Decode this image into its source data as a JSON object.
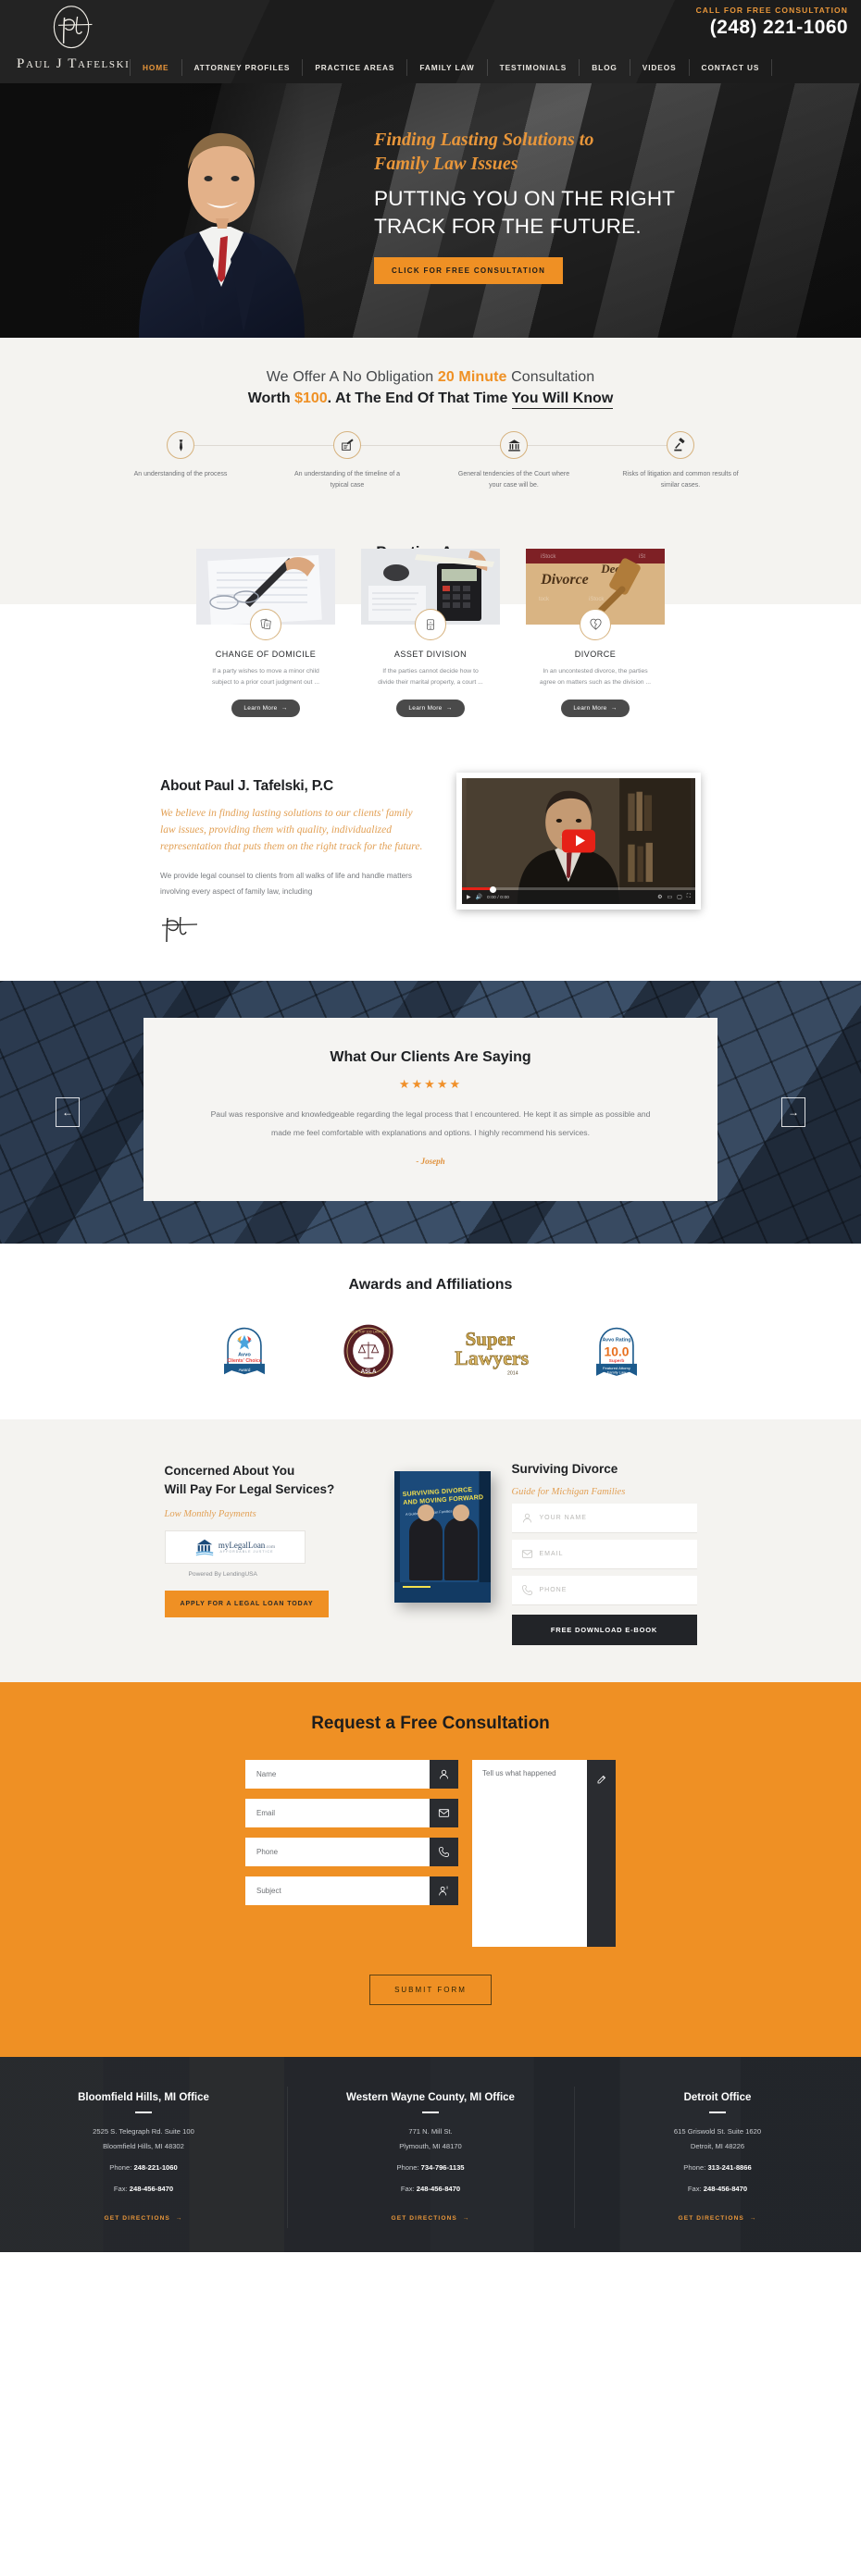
{
  "header": {
    "brand_name": "Paul J Tafelski",
    "call_label": "CALL FOR FREE CONSULTATION",
    "phone": "(248) 221-1060",
    "nav": [
      {
        "label": "HOME",
        "active": true
      },
      {
        "label": "ATTORNEY PROFILES",
        "active": false
      },
      {
        "label": "PRACTICE AREAS",
        "active": false
      },
      {
        "label": "FAMILY LAW",
        "active": false
      },
      {
        "label": "TESTIMONIALS",
        "active": false
      },
      {
        "label": "BLOG",
        "active": false
      },
      {
        "label": "VIDEOS",
        "active": false
      },
      {
        "label": "CONTACT US",
        "active": false
      }
    ]
  },
  "hero": {
    "script_line1": "Finding Lasting Solutions to",
    "script_line2": "Family Law Issues",
    "headline_line1": "PUTTING YOU ON THE RIGHT",
    "headline_line2": "TRACK FOR THE FUTURE.",
    "cta": "CLICK FOR FREE CONSULTATION"
  },
  "consult": {
    "line1_a": "We Offer A No Obligation ",
    "line1_accent": "20 Minute",
    "line1_b": " Consultation",
    "line2_a": "Worth ",
    "line2_amount": "$100",
    "line2_b": ". At The End Of That Time ",
    "line2_underline": "You Will Know",
    "steps": [
      {
        "icon": "tie-icon",
        "text": "An understanding of the process"
      },
      {
        "icon": "document-pen-icon",
        "text": "An understanding of the timeline of a typical case"
      },
      {
        "icon": "courthouse-icon",
        "text": "General tendencies of the Court where your case will be."
      },
      {
        "icon": "gavel-icon",
        "text": "Risks of litigation and common results of similar cases."
      }
    ]
  },
  "practice": {
    "title": "Practice Areas",
    "prev_arrow": "‹",
    "next_arrow": "›",
    "cards": [
      {
        "title": "CHANGE OF DOMICILE",
        "desc": "If a party wishes to move a minor child subject to a prior court judgment out ...",
        "button": "Learn More",
        "icon": "documents-icon"
      },
      {
        "title": "ASSET DIVISION",
        "desc": "If the parties cannot decide how to divide their marital property, a court ...",
        "button": "Learn More",
        "icon": "split-icon"
      },
      {
        "title": "DIVORCE",
        "desc": "In an uncontested divorce, the parties agree on matters such as the division ...",
        "button": "Learn More",
        "icon": "broken-heart-icon"
      }
    ]
  },
  "about": {
    "title": "About Paul J. Tafelski, P.C",
    "script": "We believe in finding lasting solutions to our clients' family law issues, providing them with quality, individualized representation that puts them on the right track for the future.",
    "body": "We provide legal counsel to clients from all walks of life and handle matters involving every aspect of family law, including",
    "video_time": "0:00 / 0:00"
  },
  "testimonials": {
    "title": "What Our Clients Are Saying",
    "stars": "★★★★★",
    "quote": "Paul was responsive and knowledgeable regarding the legal process that I encountered. He kept it as simple as possible and made me feel comfortable with explanations and options. I highly recommend his services.",
    "author": "- Joseph",
    "prev_arrow": "←",
    "next_arrow": "→"
  },
  "awards": {
    "title": "Awards and Affiliations",
    "badges": [
      {
        "name": "avvo-clients-choice-badge",
        "brand": "Avvo",
        "line1": "Clients' Choice",
        "year": "2014",
        "ribbon": "Award"
      },
      {
        "name": "asla-top-100-badge",
        "ring_text": "2015 TOP 100 LAWYER",
        "label": "ASLA"
      },
      {
        "name": "super-lawyers-badge",
        "line1": "Super",
        "line2": "Lawyers",
        "year": "2014"
      },
      {
        "name": "avvo-rating-badge",
        "brand": "Avvo Rating",
        "score": "10.0",
        "label": "Superb",
        "ribbon1": "Featured Attorny",
        "ribbon2": "Family Law"
      }
    ]
  },
  "services": {
    "left_title_l1": "Concerned About You",
    "left_title_l2": "Will Pay For Legal Services?",
    "left_sub": "Low Monthly Payments",
    "loan_logo_main": "myLegalLoan",
    "loan_logo_com": ".com",
    "loan_logo_tag": "AFFORDABLE JUSTICE",
    "powered_by": "Powered By LendingUSA",
    "loan_button": "APPLY FOR A LEGAL LOAN TODAY",
    "book_title": "SURVIVING DIVORCE AND MOVING FORWARD",
    "book_sub": "A Guide for Michigan Families",
    "right_title": "Surviving Divorce",
    "right_sub": "Guide for Michigan Families",
    "fields": [
      {
        "placeholder": "YOUR NAME",
        "icon": "user-icon"
      },
      {
        "placeholder": "EMAIL",
        "icon": "envelope-icon"
      },
      {
        "placeholder": "PHONE",
        "icon": "phone-icon"
      }
    ],
    "ebook_button": "FREE DOWNLOAD E-BOOK"
  },
  "request": {
    "title": "Request a Free Consultation",
    "fields": [
      {
        "placeholder": "Name",
        "icon": "user-icon"
      },
      {
        "placeholder": "Email",
        "icon": "envelope-icon"
      },
      {
        "placeholder": "Phone",
        "icon": "phone-icon"
      },
      {
        "placeholder": "Subject",
        "icon": "user-info-icon"
      }
    ],
    "message_placeholder": "Tell us what happened",
    "message_icon": "pencil-icon",
    "submit": "SUBMIT FORM"
  },
  "footer": {
    "offices": [
      {
        "name": "Bloomfield Hills, MI Office",
        "address1": "2525 S. Telegraph Rd. Suite 100",
        "address2": "Bloomfield Hills, MI 48302",
        "phone_label": "Phone: ",
        "phone": "248-221-1060",
        "fax_label": "Fax: ",
        "fax": "248-456-8470",
        "directions": "GET DIRECTIONS"
      },
      {
        "name": "Western Wayne County, MI Office",
        "address1": "771 N. Mill St.",
        "address2": "Plymouth, MI 48170",
        "phone_label": "Phone: ",
        "phone": "734-796-1135",
        "fax_label": "Fax: ",
        "fax": "248-456-8470",
        "directions": "GET DIRECTIONS"
      },
      {
        "name": "Detroit Office",
        "address1": "615 Griswold St. Suite 1620",
        "address2": "Detroit, MI 48226",
        "phone_label": "Phone: ",
        "phone": "313-241-8866",
        "fax_label": "Fax: ",
        "fax": "248-456-8470",
        "directions": "GET DIRECTIONS"
      }
    ]
  },
  "colors": {
    "accent_orange": "#ef9024",
    "dark": "#1c1c1c",
    "light_gray": "#f4f3f0",
    "footer_dark": "#23262b",
    "testimonial_blue": "#2c3b50"
  }
}
